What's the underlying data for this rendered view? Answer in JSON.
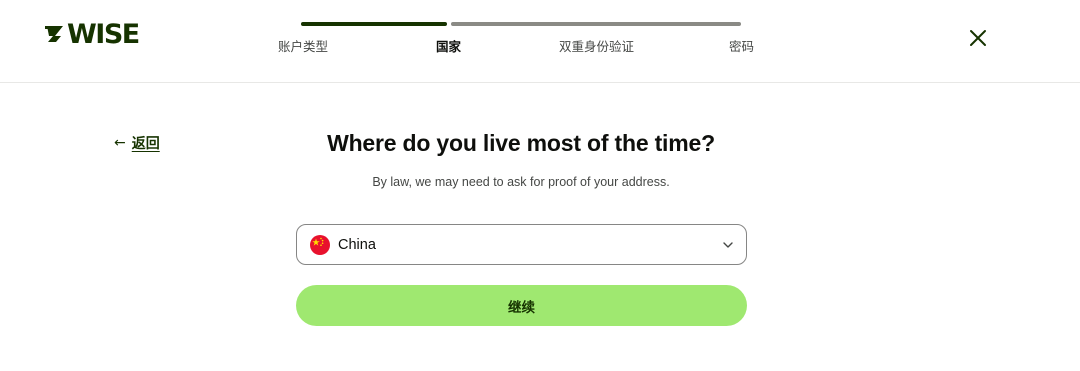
{
  "brand": {
    "name": "WISE",
    "color": "#163300",
    "accent": "#9fe870"
  },
  "header": {
    "steps": [
      {
        "label": "账户类型",
        "active": false
      },
      {
        "label": "国家",
        "active": true
      },
      {
        "label": "双重身份验证",
        "active": false
      },
      {
        "label": "密码",
        "active": false
      }
    ],
    "close_icon": "close-icon"
  },
  "nav": {
    "back_label": "返回",
    "back_icon": "arrow-left-icon"
  },
  "main": {
    "title": "Where do you live most of the time?",
    "subtitle": "By law, we may need to ask for proof of your address.",
    "country_select": {
      "value": "China",
      "flag_icon": "china-flag-icon",
      "chevron_icon": "chevron-down-icon"
    },
    "continue_label": "继续"
  }
}
